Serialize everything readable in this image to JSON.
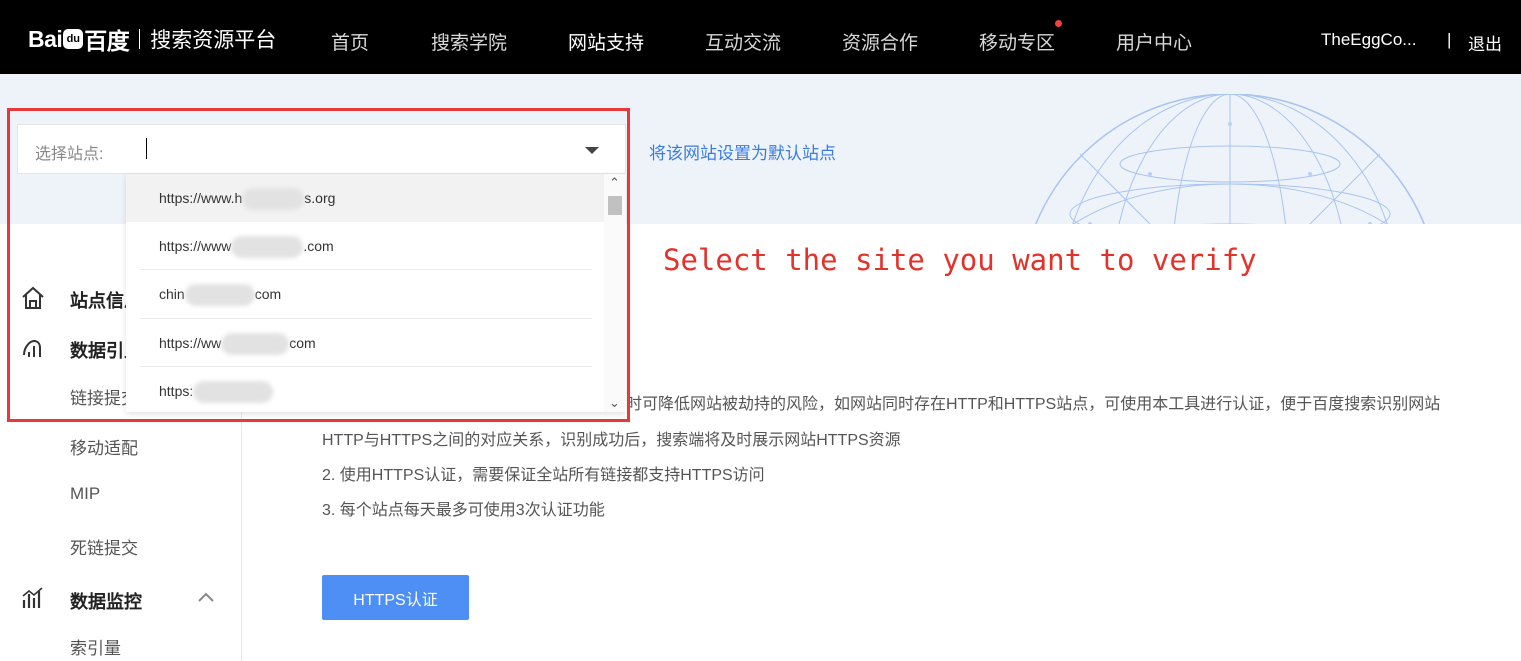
{
  "header": {
    "logo_text_left": "Bai",
    "logo_paw": "du",
    "logo_text_right": "百度",
    "platform_name": "搜索资源平台",
    "nav": [
      "首页",
      "搜索学院",
      "网站支持",
      "互动交流",
      "资源合作",
      "移动专区",
      "用户中心"
    ],
    "active_nav": "网站支持",
    "user_name": "TheEggCo...",
    "separator": "|",
    "logout": "退出"
  },
  "site_selector": {
    "label": "选择站点:",
    "set_default_link": "将该网站设置为默认站点",
    "options": [
      {
        "prefix": "https://www.h",
        "suffix": "s.org"
      },
      {
        "prefix": "https://www",
        "suffix": ".com"
      },
      {
        "prefix": "chin",
        "suffix": "com"
      },
      {
        "prefix": "https://ww",
        "suffix": "com"
      },
      {
        "prefix": "https:",
        "suffix": ""
      }
    ]
  },
  "annotation": "Select the site you want to verify",
  "sidebar": {
    "sections": [
      {
        "label": "站点信息",
        "icon": "home-icon"
      },
      {
        "label": "数据引入",
        "icon": "data-import-icon"
      },
      {
        "label": "数据监控",
        "icon": "chart-icon"
      }
    ],
    "sub_items": [
      "链接提交",
      "移动适配",
      "MIP",
      "死链提交",
      "索引量"
    ]
  },
  "content": {
    "line1_tail": "时可降低网站被劫持的风险，如网站同时存在HTTP和HTTPS站点，可使用本工具进行认证，便于百度搜索识别网站",
    "line2": "HTTP与HTTPS之间的对应关系，识别成功后，搜索端将及时展示网站HTTPS资源",
    "line3": "2. 使用HTTPS认证，需要保证全站所有链接都支持HTTPS访问",
    "line4": "3. 每个站点每天最多可使用3次认证功能",
    "button": "HTTPS认证"
  },
  "colors": {
    "accent": "#4e8ff6",
    "link": "#3a7ce0",
    "annotation": "#e3322b",
    "topbar": "#000000"
  }
}
